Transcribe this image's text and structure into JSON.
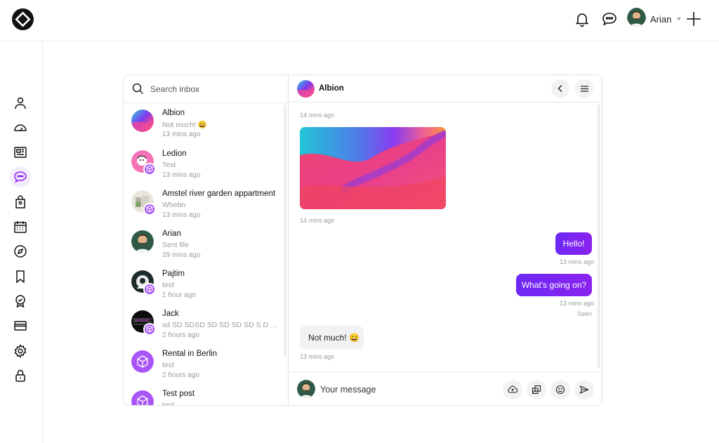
{
  "user": {
    "name": "Arian"
  },
  "search": {
    "placeholder": "Search inbox"
  },
  "conversations": [
    {
      "name": "Albion",
      "preview": "Not much! 😀",
      "time": "13 mins ago"
    },
    {
      "name": "Ledion",
      "preview": "Test",
      "time": "13 mins ago"
    },
    {
      "name": "Amstel river garden appartment",
      "preview": "Whebn",
      "time": "13 mins ago"
    },
    {
      "name": "Arian",
      "preview": "Sent file",
      "time": "29 mins ago"
    },
    {
      "name": "Pajtim",
      "preview": "test",
      "time": "1 hour ago"
    },
    {
      "name": "Jack",
      "preview": "sd SD SDSD SD SD SD SD S D SD SD SD SD",
      "time": "2 hours ago"
    },
    {
      "name": "Rental in Berlin",
      "preview": "test",
      "time": "2 hours ago"
    },
    {
      "name": "Test post",
      "preview": "test",
      "time": ""
    }
  ],
  "chat": {
    "title": "Albion",
    "messages": [
      {
        "from": "them",
        "type": "text",
        "text": "",
        "time": "14 mins ago"
      },
      {
        "from": "them",
        "type": "image",
        "time": "14 mins ago"
      },
      {
        "from": "me",
        "type": "text",
        "text": "Hello!",
        "time": "13 mins ago"
      },
      {
        "from": "me",
        "type": "text",
        "text": "What's going on?",
        "time": "13 mins ago",
        "status": "Seen"
      },
      {
        "from": "them",
        "type": "text",
        "text": "Not much! 😀",
        "time": "13 mins ago"
      }
    ],
    "composer_placeholder": "Your message"
  },
  "sidebar": {
    "items": [
      "user-icon",
      "dashboard-icon",
      "news-icon",
      "chat-icon",
      "location-bag-icon",
      "calendar-icon",
      "compass-icon",
      "bookmark-icon",
      "badge-icon",
      "card-icon",
      "settings-icon",
      "lock-icon"
    ],
    "active": "chat-icon"
  },
  "colors": {
    "accent": "#8b23f0",
    "accent_light": "#f3ecfd",
    "badge": "#a855f7"
  }
}
